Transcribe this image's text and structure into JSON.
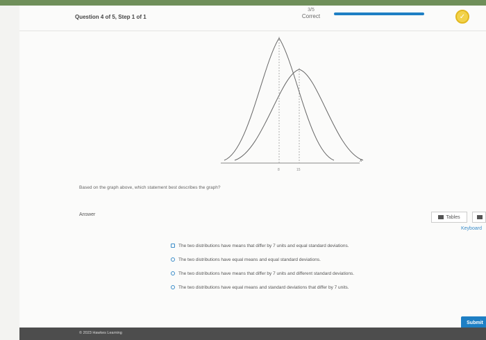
{
  "header": {
    "question_step": "Question 4 of 5, Step 1 of 1",
    "score_fraction": "3/5",
    "score_status": "Correct"
  },
  "graph": {
    "x_axis_label": "x",
    "tick_left": "8",
    "tick_right": "15"
  },
  "question": {
    "prompt": "Based on the graph above, which statement best describes the graph?",
    "answer_label": "Answer"
  },
  "tools": {
    "tables_label": "Tables",
    "keyboard_label": "Keyboard"
  },
  "options": [
    "The two distributions have means that differ by 7 units and equal standard deviations.",
    "The two distributions have equal means and equal standard deviations.",
    "The two distributions have means that differ by 7 units and different standard deviations.",
    "The two distributions have equal means and standard deviations that differ by 7 units."
  ],
  "submit_label": "Submit",
  "footer": {
    "copyright": "© 2023 Hawkes Learning"
  },
  "colors": {
    "accent": "#1e7fc4",
    "top_bar": "#6f8f5a",
    "footer": "#4d4d4d",
    "badge": "#f2d24a"
  }
}
